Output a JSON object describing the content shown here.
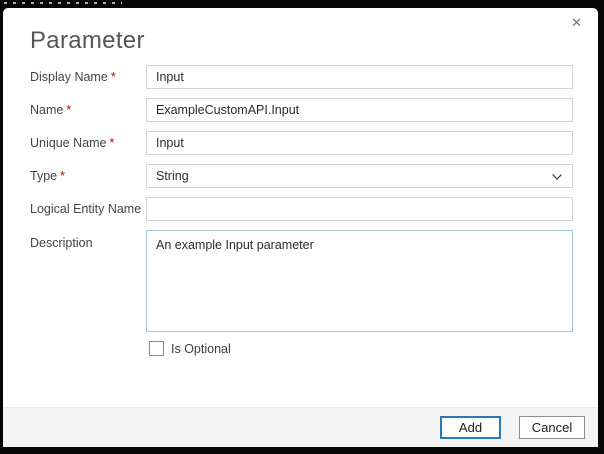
{
  "dialog": {
    "title": "Parameter",
    "close_icon": "✕",
    "required_marker": "*"
  },
  "fields": [
    {
      "label": "Display Name",
      "required": "*",
      "value": "Input",
      "type": "text"
    },
    {
      "label": "Name",
      "required": "*",
      "value": "ExampleCustomAPI.Input",
      "type": "text"
    },
    {
      "label": "Unique Name",
      "required": "*",
      "value": "Input",
      "type": "text"
    },
    {
      "label": "Type",
      "required": "*",
      "value": "String",
      "type": "select"
    },
    {
      "label": "Logical Entity Name",
      "value": "",
      "type": "text"
    },
    {
      "label": "Description",
      "value": "An example Input parameter",
      "type": "textarea"
    }
  ],
  "optional_checkbox": {
    "label": "Is Optional",
    "checked": false
  },
  "buttons": {
    "add": "Add",
    "cancel": "Cancel"
  },
  "colors": {
    "accent_blue": "#2779bf",
    "textarea_border_blue": "#a5c7dc",
    "required_red": "#cc0000",
    "footer_bg": "#f4f4f4",
    "frame_black": "#060606"
  }
}
